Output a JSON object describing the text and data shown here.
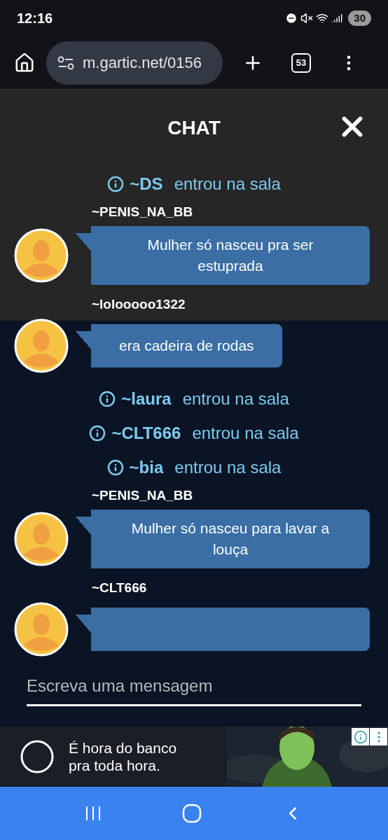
{
  "status_bar": {
    "time": "12:16",
    "battery": "30"
  },
  "browser": {
    "url": "m.gartic.net/0156",
    "tab_count": "53"
  },
  "chat": {
    "title": "CHAT",
    "messages": [
      {
        "kind": "system",
        "name": "~DS",
        "text": "entrou na sala"
      },
      {
        "kind": "user",
        "name": "~PENIS_NA_BB",
        "text": "Mulher só nasceu pra ser estuprada"
      },
      {
        "kind": "user",
        "name": "~lolooooo1322",
        "text": "era cadeira de rodas"
      },
      {
        "kind": "system",
        "name": "~laura",
        "text": "entrou na sala"
      },
      {
        "kind": "system",
        "name": "~CLT666",
        "text": "entrou na sala"
      },
      {
        "kind": "system",
        "name": "~bia",
        "text": "entrou na sala"
      },
      {
        "kind": "user",
        "name": "~PENIS_NA_BB",
        "text": "Mulher só nasceu para lavar a louça"
      },
      {
        "kind": "user",
        "name": "~CLT666"
      }
    ],
    "input": {
      "placeholder": "Escreva uma mensagem"
    }
  },
  "ad": {
    "lines": [
      "É hora do banco",
      "pra toda hora."
    ]
  }
}
